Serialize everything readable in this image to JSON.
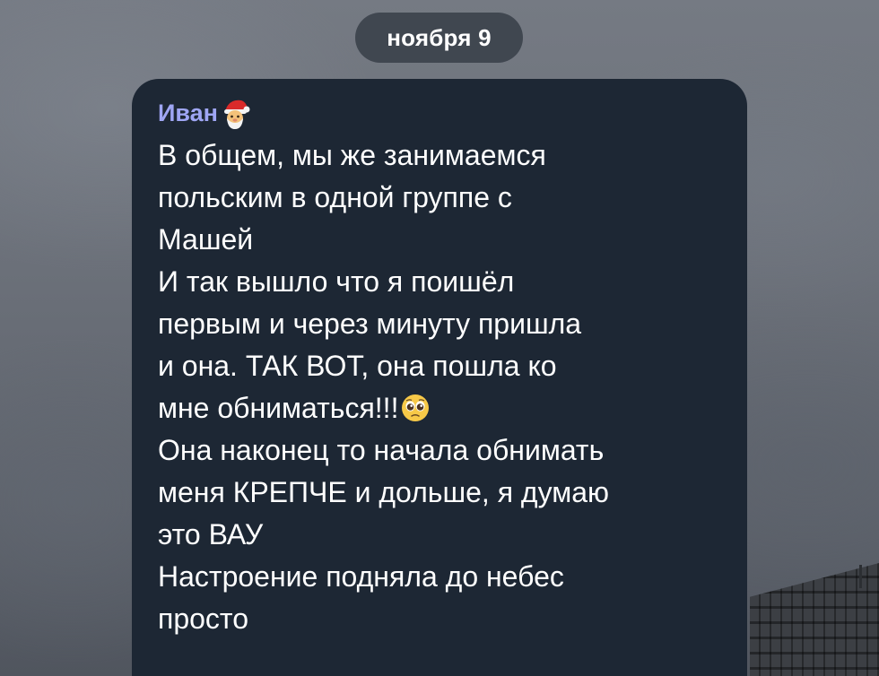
{
  "chat": {
    "date_separator": "ноября 9",
    "message": {
      "sender_name": "Иван",
      "sender_emoji": "santa-face-emoji",
      "lines": [
        "В общем, мы же занимаемся",
        "польским в одной группе с",
        "Машей",
        "И так вышло что я поишёл",
        "первым и через минуту пришла",
        "и она. ТАК ВОТ, она пошла ко",
        "мне обниматься!!!",
        "Она наконец то начала обнимать",
        "меня КРЕПЧЕ и дольше, я думаю",
        "это ВАУ",
        "Настроение подняла до небес",
        "просто"
      ],
      "inline_emoji": "pleading-face-emoji"
    }
  },
  "colors": {
    "bubble": "#1d2734",
    "sender_name": "#9fa6f4",
    "text": "#ffffff",
    "date_pill": "#343c46"
  }
}
